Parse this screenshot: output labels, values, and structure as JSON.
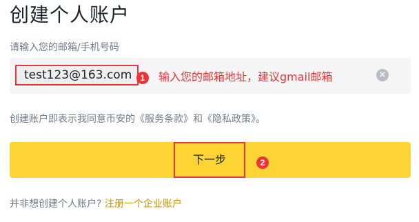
{
  "page": {
    "title": "创建个人账户"
  },
  "email_field": {
    "label": "请输入您的邮箱/手机号码",
    "value": "test123@163.com",
    "clear_icon": "close-circle-icon"
  },
  "annotations": {
    "step1_badge": "1",
    "step1_text": "输入您的邮箱地址，建议gmail邮箱",
    "step2_badge": "2",
    "color": "#ee3436"
  },
  "terms": {
    "text": "创建账户即表示我同意币安的《服务条款》和《隐私政策》。"
  },
  "next_button": {
    "label": "下一步",
    "color": "#fcd535"
  },
  "footer": {
    "question": "并非想创建个人账户?",
    "link_label": "注册一个企业账户",
    "link_color": "#c99400"
  }
}
